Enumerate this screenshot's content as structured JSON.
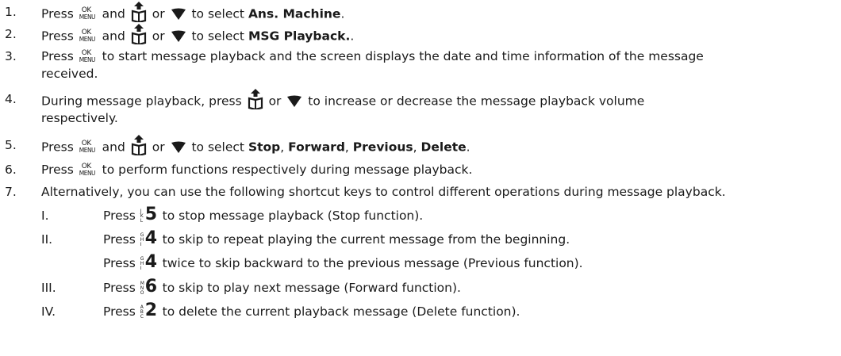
{
  "icons": {
    "ok_top": "OK",
    "ok_bottom": "MENU",
    "up_key": "phonebook-up-icon",
    "down_key": "down-arrow-icon",
    "key5": {
      "digit": "5",
      "letters": [
        "J",
        "K",
        "L"
      ]
    },
    "key4": {
      "digit": "4",
      "letters": [
        "G",
        "H",
        "I"
      ]
    },
    "key6": {
      "digit": "6",
      "letters": [
        "M",
        "N",
        "O"
      ]
    },
    "key2": {
      "digit": "2",
      "letters": [
        "A",
        "B",
        "C"
      ]
    }
  },
  "steps": [
    {
      "num": "1.",
      "a": "Press",
      "b": "and",
      "c": "or",
      "d": "to select",
      "bold": "Ans. Machine",
      "end": "."
    },
    {
      "num": "2.",
      "a": "Press",
      "b": "and",
      "c": "or",
      "d": "to select",
      "bold": "MSG Playback.",
      "end": "."
    },
    {
      "num": "3.",
      "a": "Press",
      "b": "to start message playback and the screen displays the date and time information of the message",
      "cont": "received."
    },
    {
      "num": "4.",
      "a": "During message playback, press",
      "c": "or",
      "d": "to increase or decrease the message playback volume",
      "cont": "respectively."
    },
    {
      "num": "5.",
      "a": "Press",
      "b": "and",
      "c": "or",
      "d": "to select",
      "bold1": "Stop",
      "sep1": ",",
      "bold2": "Forward",
      "sep2": ",",
      "bold3": "Previous",
      "sep3": ",",
      "bold4": "Delete",
      "end": "."
    },
    {
      "num": "6.",
      "a": "Press",
      "b": "to perform functions respectively during message playback."
    },
    {
      "num": "7.",
      "a": "Alternatively, you can use the following shortcut keys to control different operations during message playback."
    }
  ],
  "sub": [
    {
      "num": "I.",
      "a": "Press",
      "b": "to stop message playback (Stop function)."
    },
    {
      "num": "II.",
      "a": "Press",
      "b": "to skip to repeat playing the current message from the beginning."
    },
    {
      "num": "",
      "a": "Press",
      "b": "twice to skip backward to the previous message (Previous function)."
    },
    {
      "num": "III.",
      "a": "Press",
      "b": "to skip to play next message (Forward function)."
    },
    {
      "num": "IV.",
      "a": "Press",
      "b": "to delete the current playback message (Delete function)."
    }
  ]
}
